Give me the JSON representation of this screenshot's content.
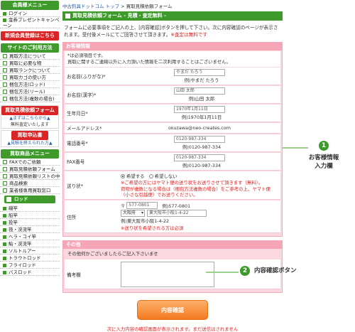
{
  "sidebar": {
    "member_menu": "会員様メニュー",
    "member_items": [
      "ログイン",
      "金券プレゼントキャンペーン"
    ],
    "register": "新規会員登録はこちら",
    "guide_head": "サイトのご利用方法",
    "guide_items": [
      "買取方法について",
      "買取に必要な物",
      "買取ランクについて",
      "買取カゴの使い方",
      "梱包方法(ロッド)",
      "梱包方法(リール)",
      "梱包方法(複数の場合)"
    ],
    "quote_head": "買取見積依頼フォーム",
    "quote_sub1": "▲まずはこちらから▲",
    "quote_sub2": "無料査定いたします",
    "apply_head": "買取申込書",
    "apply_sub": "▲見積を終えられた方▲",
    "product_head": "買取商品メニュー",
    "product_items": [
      "FAXでのご依頼",
      "買取見積依頼フォーム",
      "買取見積依頼リストの中",
      "商品検索",
      "業者様専用買取窓口"
    ],
    "rod_button": "ロッド",
    "rod_items": [
      "磯竿",
      "船竿",
      "投竿",
      "筏・渓流竿",
      "へラ・コイ竿",
      "鮎・渓流竿",
      "ソルトルアー",
      "トラウトロッド",
      "フライロッド",
      "バスロッド"
    ]
  },
  "main": {
    "breadcrumb_home": "中古釣具ドットコム トップ",
    "breadcrumb_sep": " > ",
    "breadcrumb_current": "買取見積依頼フォーム",
    "title": "買取見積依頼フォーム - 見積・査定無料 -",
    "intro_text": "フォームに必要事項をご記入の上、[内容確認]ボタンを押して下さい。次に内容確認のページが表示されます。受付後メールにてご回答させて頂きます。",
    "intro_red": "※査定は無料です"
  },
  "form": {
    "section1": "お客様情報",
    "note1": "*は必須項目です。",
    "note2": "買取に関するご連絡以外に入力頂いた情報を二次利用することはございません。",
    "furigana_label": "お名前(ふりがな)*",
    "furigana_value": "やまだ たろう",
    "furigana_ex": "例)やまだ たろう",
    "kanji_label": "お名前(漢字)*",
    "kanji_value": "山田 太郎",
    "kanji_ex": "例)山田 太郎",
    "birth_label": "生年月日*",
    "birth_value": "1970年1月11日",
    "birth_ex": "例)1970年1月11日",
    "email_label": "メールアドレス*",
    "email_value": "okuzawa@neo-creates.com",
    "tel_label": "電話番号*",
    "tel_value": "0120-987-334",
    "tel_ex": "例)0120-987-334",
    "fax_label": "FAX番号",
    "fax_value": "0120-987-334",
    "fax_ex": "例)0120-987-334",
    "kit_label": "送り状*",
    "kit_opt1": "希望する",
    "kit_opt2": "希望しない",
    "kit_note1": "※ご希望の方にはヤマト便の送り状をお送りさせて頂きます（無料）。",
    "kit_note2": "荷物が複数になる場合は（梱包方法複数の場合）をご参考の上、ヤマト便（小さな引越便）でお送りください。",
    "address_label": "住所",
    "zip_prefix": "〒",
    "zip_value": "577-0801",
    "zip_ex": "例)577-0801",
    "pref_value": "大阪府",
    "city_value": "東大阪市小阪1-4-22",
    "addr_ex": "例)東大阪市小阪1-4-22",
    "addr_note": "※送り状を希望される方は必須",
    "section2": "その他",
    "other_note": "その他何かございましたらご記入下さいませ",
    "remarks_label": "備考欄",
    "submit": "内容確認",
    "submit_note": "次に入力内容の確認画面が表示されます。まだ送信はされません"
  },
  "callouts": {
    "c1_num": "1",
    "c1_text1": "お客様情報",
    "c1_text2": "入力欄",
    "c2_num": "2",
    "c2_text": "内容確認ボタン"
  }
}
